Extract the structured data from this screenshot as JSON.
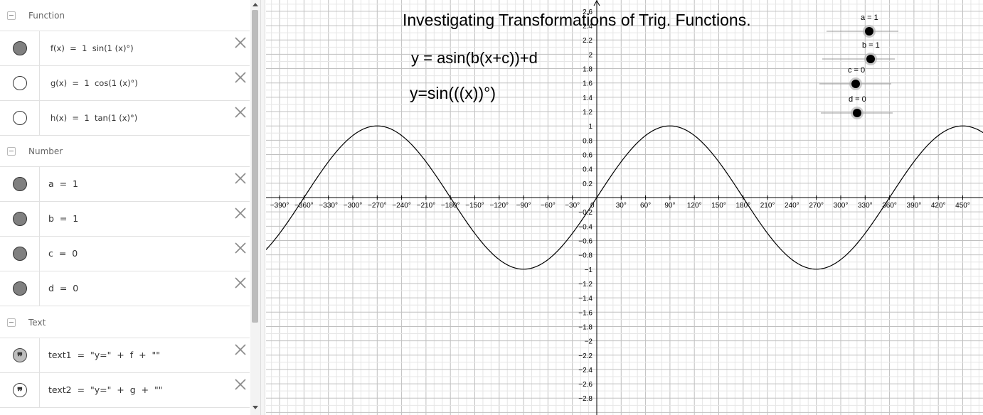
{
  "algebra": {
    "groups": {
      "function": "Function",
      "number": "Number",
      "text": "Text"
    },
    "functions": [
      {
        "expr": "f(x)  =  1  sin(1 (x)°)",
        "visible": true
      },
      {
        "expr": "g(x)  =  1  cos(1 (x)°)",
        "visible": false
      },
      {
        "expr": "h(x)  =  1  tan(1 (x)°)",
        "visible": false
      }
    ],
    "numbers": [
      {
        "expr": "a  =  1"
      },
      {
        "expr": "b  =  1"
      },
      {
        "expr": "c  =  0"
      },
      {
        "expr": "d  =  0"
      }
    ],
    "texts": [
      {
        "expr": "text1  =  \"y=\"  +  f  +  \"\"",
        "visible": true
      },
      {
        "expr": "text2  =  \"y=\"  +  g  +  \"\"",
        "visible": false
      }
    ],
    "quote_glyph": "❞"
  },
  "graphics": {
    "title": "Investigating Transformations of Trig. Functions.",
    "formula": "y = asin(b(x+c))+d",
    "current": "y=sin(((x))°)",
    "sliders": [
      {
        "label": "a = 1",
        "value": 1
      },
      {
        "label": "b = 1",
        "value": 1
      },
      {
        "label": "c = 0",
        "value": 0
      },
      {
        "label": "d = 0",
        "value": 0
      }
    ],
    "x_ticks": [
      "−390°",
      "−360°",
      "−330°",
      "−300°",
      "−270°",
      "−240°",
      "−210°",
      "−180°",
      "−150°",
      "−120°",
      "−90°",
      "−60°",
      "−30°",
      "0",
      "30°",
      "60°",
      "90°",
      "120°",
      "150°",
      "180°",
      "210°",
      "240°",
      "270°",
      "300°",
      "330°",
      "360°",
      "390°",
      "420°",
      "450°"
    ],
    "x_tick_values": [
      -390,
      -360,
      -330,
      -300,
      -270,
      -240,
      -210,
      -180,
      -150,
      -120,
      -90,
      -60,
      -30,
      0,
      30,
      60,
      90,
      120,
      150,
      180,
      210,
      240,
      270,
      300,
      330,
      360,
      390,
      420,
      450
    ],
    "y_ticks_pos": [
      "2.6",
      "2.4",
      "2.2",
      "2",
      "1.8",
      "1.6",
      "1.4",
      "1.2",
      "1",
      "0.8",
      "0.6",
      "0.4",
      "0.2"
    ],
    "y_ticks_neg": [
      "−0.2",
      "−0.4",
      "−0.6",
      "−0.8",
      "−1",
      "−1.2",
      "−1.4",
      "−1.6",
      "−1.8",
      "−2",
      "−2.2",
      "−2.4",
      "−2.6",
      "−2.8"
    ],
    "curve": {
      "amplitude": 1,
      "period_factor": 1,
      "phase_deg": 0,
      "vertical_shift": 0
    },
    "colors": {
      "grid_minor": "#e6e6e6",
      "grid_major": "#c0c0c0",
      "axis": "#000000",
      "curve": "#000000"
    }
  }
}
